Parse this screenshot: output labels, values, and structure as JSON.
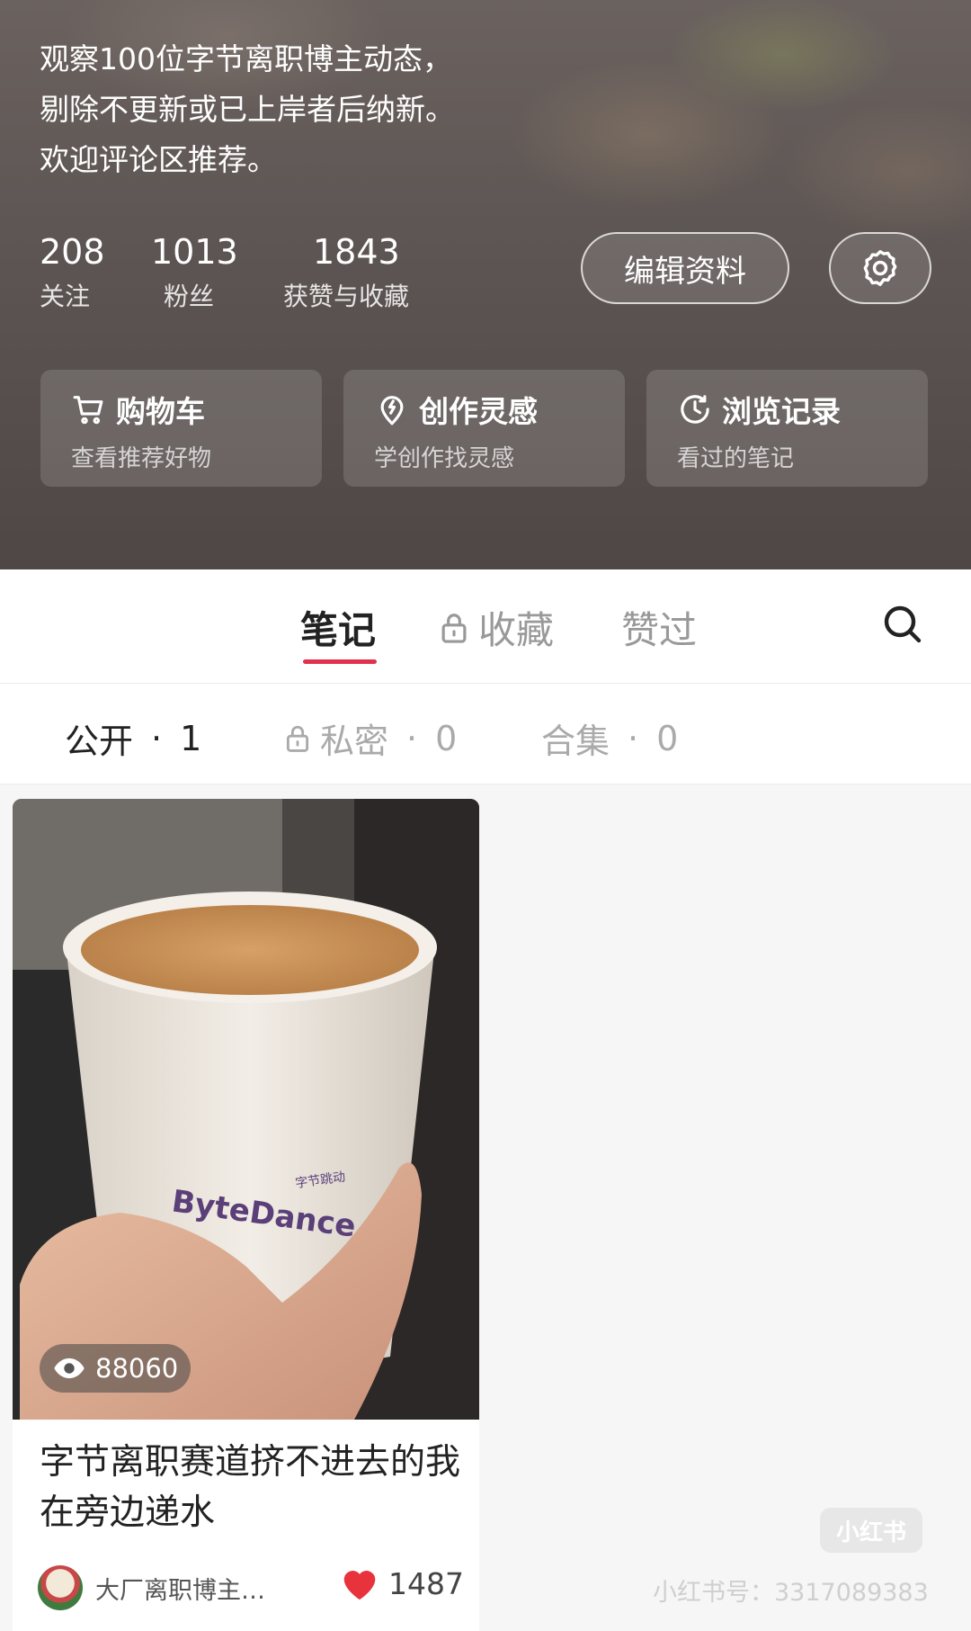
{
  "profile": {
    "bio": [
      "观察100位字节离职博主动态，",
      "剔除不更新或已上岸者后纳新。",
      "欢迎评论区推荐。"
    ],
    "stats": [
      {
        "value": "208",
        "label": "关注"
      },
      {
        "value": "1013",
        "label": "粉丝"
      },
      {
        "value": "1843",
        "label": "获赞与收藏"
      }
    ],
    "edit_label": "编辑资料"
  },
  "cards": [
    {
      "title": "购物车",
      "subtitle": "查看推荐好物",
      "icon": "cart-icon"
    },
    {
      "title": "创作灵感",
      "subtitle": "学创作找灵感",
      "icon": "bulb-icon"
    },
    {
      "title": "浏览记录",
      "subtitle": "看过的笔记",
      "icon": "clock-icon"
    }
  ],
  "tabs": [
    {
      "label": "笔记",
      "active": true
    },
    {
      "label": "收藏",
      "locked": true
    },
    {
      "label": "赞过"
    }
  ],
  "subtabs": [
    {
      "label": "公开",
      "count": "1",
      "active": true
    },
    {
      "label": "私密",
      "count": "0",
      "locked": true
    },
    {
      "label": "合集",
      "count": "0"
    }
  ],
  "note": {
    "views": "88060",
    "title": "字节离职赛道挤不进去的我在旁边递水",
    "author": "大厂离职博主…",
    "likes": "1487",
    "cup_brand": "ByteDance",
    "cup_brand_cn": "字节跳动"
  },
  "watermark": {
    "logo": "小红书",
    "id_text": "小红书号：3317089383"
  },
  "colors": {
    "accent": "#e0324c",
    "like": "#e8323c",
    "header_bg": "#5e5654"
  }
}
